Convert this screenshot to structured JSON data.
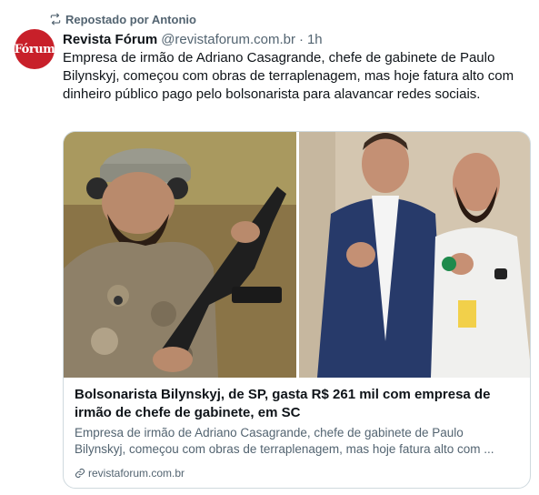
{
  "repost": {
    "text": "Repostado por Antonio"
  },
  "author": {
    "avatar_text": "Fórum",
    "name": "Revista Fórum",
    "handle": "@revistaforum.com.br",
    "separator": "·",
    "time": "1h"
  },
  "post": {
    "text": "Empresa de irmão de Adriano Casagrande, chefe de gabinete de Paulo Bilynskyj, começou com obras de terraplenagem, mas hoje fatura alto com dinheiro público pago pelo bolsonarista para alavancar redes sociais."
  },
  "link_card": {
    "title": "Bolsonarista Bilynskyj, de SP, gasta R$ 261 mil com empresa de irmão de chefe de gabinete, em SC",
    "description_line1": "Empresa de irmão de Adriano Casagrande, chefe de gabinete de Paulo",
    "description_line2": "Bilynskyj, começou com obras de terraplenagem, mas hoje fatura alto com ...",
    "domain": "revistaforum.com.br"
  },
  "colors": {
    "accent_avatar": "#c8202a",
    "text_primary": "#0f1419",
    "text_secondary": "#536471",
    "border": "#cfd9de"
  },
  "icons": {
    "repost": "repost-icon",
    "link": "link-icon"
  }
}
